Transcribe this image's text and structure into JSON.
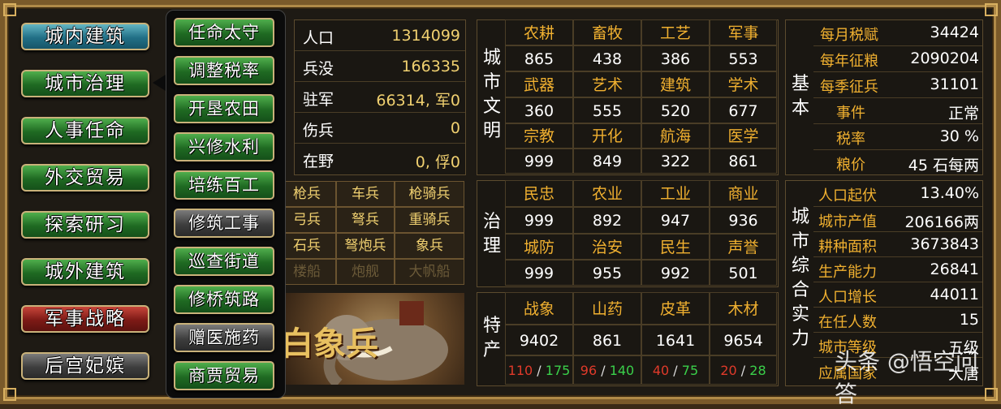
{
  "main_menu": [
    {
      "label": "城内建筑",
      "style": "teal"
    },
    {
      "label": "城市治理",
      "style": "green"
    },
    {
      "label": "人事任命",
      "style": "green"
    },
    {
      "label": "外交贸易",
      "style": "green"
    },
    {
      "label": "探索研习",
      "style": "green"
    },
    {
      "label": "城外建筑",
      "style": "green"
    },
    {
      "label": "军事战略",
      "style": "red"
    },
    {
      "label": "后宫妃嫔",
      "style": "gray"
    }
  ],
  "sub_menu": [
    {
      "label": "任命太守",
      "style": "green"
    },
    {
      "label": "调整税率",
      "style": "green"
    },
    {
      "label": "开垦农田",
      "style": "green"
    },
    {
      "label": "兴修水利",
      "style": "green"
    },
    {
      "label": "培练百工",
      "style": "green"
    },
    {
      "label": "修筑工事",
      "style": "gray"
    },
    {
      "label": "巡查街道",
      "style": "green"
    },
    {
      "label": "修桥筑路",
      "style": "green"
    },
    {
      "label": "赠医施药",
      "style": "gray"
    },
    {
      "label": "商贾贸易",
      "style": "green"
    }
  ],
  "population": [
    {
      "label": "人口",
      "value": "1314099"
    },
    {
      "label": "兵没",
      "value": "166335"
    },
    {
      "label": "驻军",
      "value": "66314, 军0"
    },
    {
      "label": "伤兵",
      "value": "0"
    },
    {
      "label": "在野",
      "value": "0, 俘0"
    }
  ],
  "units": {
    "rows": [
      [
        {
          "label": "枪兵",
          "dim": false
        },
        {
          "label": "车兵",
          "dim": false
        },
        {
          "label": "枪骑兵",
          "dim": false
        }
      ],
      [
        {
          "label": "弓兵",
          "dim": false
        },
        {
          "label": "弩兵",
          "dim": false
        },
        {
          "label": "重骑兵",
          "dim": false
        }
      ],
      [
        {
          "label": "石兵",
          "dim": false
        },
        {
          "label": "弩炮兵",
          "dim": false
        },
        {
          "label": "象兵",
          "dim": false
        }
      ],
      [
        {
          "label": "楼船",
          "dim": true
        },
        {
          "label": "炮舰",
          "dim": true
        },
        {
          "label": "大帆船",
          "dim": true
        }
      ]
    ],
    "picture_caption": "白象兵"
  },
  "civilization": {
    "title": "城市文明",
    "grid": [
      [
        "农耕",
        "畜牧",
        "工艺",
        "军事"
      ],
      [
        "865",
        "438",
        "386",
        "553"
      ],
      [
        "武器",
        "艺术",
        "建筑",
        "学术"
      ],
      [
        "360",
        "555",
        "520",
        "677"
      ],
      [
        "宗教",
        "开化",
        "航海",
        "医学"
      ],
      [
        "999",
        "849",
        "322",
        "861"
      ]
    ]
  },
  "governance": {
    "title": "治理",
    "grid": [
      [
        "民忠",
        "农业",
        "工业",
        "商业"
      ],
      [
        "999",
        "892",
        "947",
        "936"
      ],
      [
        "城防",
        "治安",
        "民生",
        "声誉"
      ],
      [
        "999",
        "955",
        "992",
        "501"
      ]
    ]
  },
  "specialty": {
    "title": "特产",
    "names": [
      "战象",
      "山药",
      "皮革",
      "木材"
    ],
    "values": [
      "9402",
      "861",
      "1641",
      "9654"
    ],
    "pairs": [
      [
        "110",
        "175"
      ],
      [
        "96",
        "140"
      ],
      [
        "40",
        "75"
      ],
      [
        "20",
        "28"
      ]
    ],
    "colors": {
      "first": "#e03a2a",
      "second": "#3ad04a"
    }
  },
  "basic": {
    "title": "基本",
    "rows": [
      {
        "label": "每月税赋",
        "value": "34424"
      },
      {
        "label": "每年征粮",
        "value": "2090204"
      },
      {
        "label": "每季征兵",
        "value": "31101"
      },
      {
        "label": "事件",
        "value": "正常"
      },
      {
        "label": "税率",
        "value": "30 %"
      },
      {
        "label": "粮价",
        "value": "45 石每两"
      }
    ]
  },
  "strength": {
    "title": "城市综合实力",
    "rows": [
      {
        "label": "人口起伏",
        "value": "13.40%"
      },
      {
        "label": "城市产值",
        "value": "206166两"
      },
      {
        "label": "耕种面积",
        "value": "3673843"
      },
      {
        "label": "生产能力",
        "value": "26841"
      },
      {
        "label": "人口增长",
        "value": "44011"
      },
      {
        "label": "在任人数",
        "value": "15"
      },
      {
        "label": "城市等级",
        "value": "五级"
      },
      {
        "label": "应属国家",
        "value": "大唐"
      }
    ]
  },
  "watermark": "头条 @悟空问答",
  "colors": {
    "header": "#f0b030",
    "value": "#f0d070",
    "accent_green": "#1f6a22",
    "frame": "#7a5a2a"
  }
}
